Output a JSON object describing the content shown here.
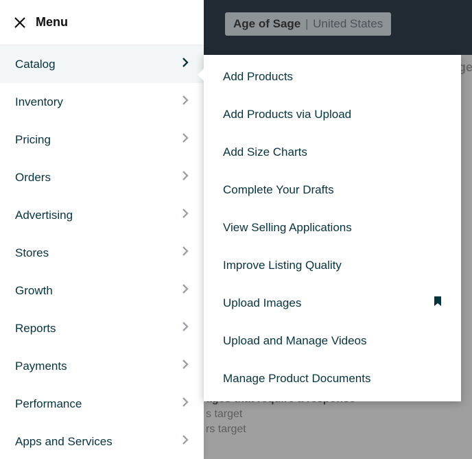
{
  "header": {
    "menu_label": "Menu",
    "brand_name": "Age of Sage",
    "brand_region": "United States"
  },
  "background": {
    "fragment_right": "ge",
    "line1": "ages that require a response",
    "line2": "s target",
    "line3": "rs target"
  },
  "menu": {
    "items": [
      {
        "label": "Catalog",
        "active": true
      },
      {
        "label": "Inventory"
      },
      {
        "label": "Pricing"
      },
      {
        "label": "Orders"
      },
      {
        "label": "Advertising"
      },
      {
        "label": "Stores"
      },
      {
        "label": "Growth"
      },
      {
        "label": "Reports"
      },
      {
        "label": "Payments"
      },
      {
        "label": "Performance"
      },
      {
        "label": "Apps and Services"
      }
    ]
  },
  "submenu": {
    "items": [
      {
        "label": "Add Products"
      },
      {
        "label": "Add Products via Upload"
      },
      {
        "label": "Add Size Charts"
      },
      {
        "label": "Complete Your Drafts"
      },
      {
        "label": "View Selling Applications"
      },
      {
        "label": "Improve Listing Quality"
      },
      {
        "label": "Upload Images",
        "bookmarked": true
      },
      {
        "label": "Upload and Manage Videos"
      },
      {
        "label": "Manage Product Documents"
      }
    ]
  }
}
